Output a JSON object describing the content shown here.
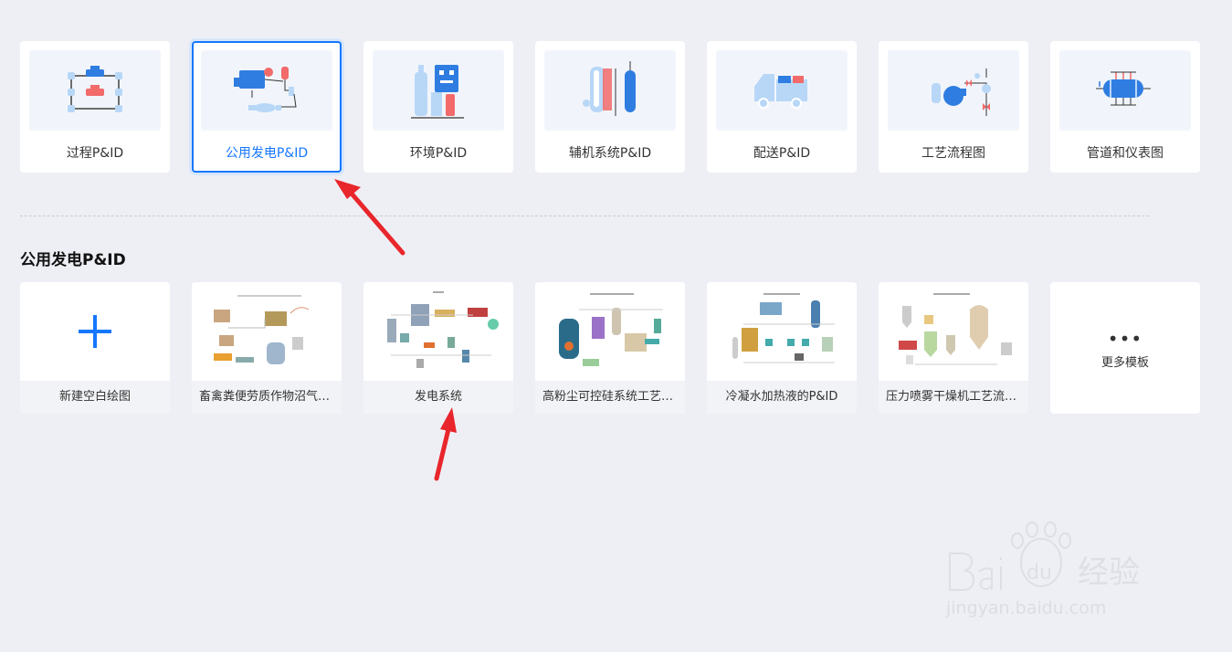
{
  "categories": [
    {
      "label": "过程P&ID",
      "icon": "valve-pipeline-icon",
      "selected": false
    },
    {
      "label": "公用发电P&ID",
      "icon": "generator-equipment-icon",
      "selected": true
    },
    {
      "label": "环境P&ID",
      "icon": "tanks-control-panel-icon",
      "selected": false
    },
    {
      "label": "辅机系统P&ID",
      "icon": "column-tank-icon",
      "selected": false
    },
    {
      "label": "配送P&ID",
      "icon": "tanker-truck-icon",
      "selected": false
    },
    {
      "label": "工艺流程图",
      "icon": "pump-valve-icon",
      "selected": false
    },
    {
      "label": "管道和仪表图",
      "icon": "heat-exchanger-icon",
      "selected": false
    }
  ],
  "section": {
    "title": "公用发电P&ID"
  },
  "templates": [
    {
      "label": "新建空白绘图",
      "type": "blank"
    },
    {
      "label": "畜禽粪便劳质作物沼气发电工程",
      "type": "template"
    },
    {
      "label": "发电系统",
      "type": "template"
    },
    {
      "label": "高粉尘可控硅系统工艺流程图",
      "type": "template"
    },
    {
      "label": "冷凝水加热液的P&ID",
      "type": "template"
    },
    {
      "label": "压力喷雾干燥机工艺流程图",
      "type": "template"
    }
  ],
  "more": {
    "dots": "•••",
    "label": "更多模板"
  },
  "watermark": {
    "text": "jingyan.baidu.com",
    "brand": "Bai du 经验"
  },
  "colors": {
    "accent": "#1677ff",
    "annotation_arrow": "#e8262b",
    "icon_light": "#b8d7f7",
    "icon_blue": "#2f7de1",
    "icon_red": "#f26a6a"
  }
}
